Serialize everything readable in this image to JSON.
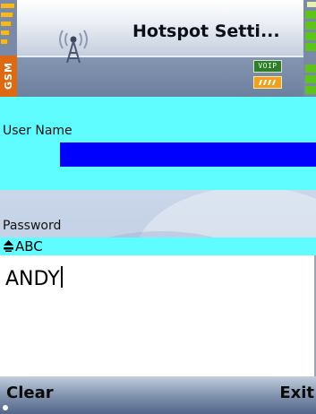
{
  "status_bar": {
    "title": "Hotspot Setti...",
    "network_label": "GSM",
    "voip_badge": "VOIP",
    "icons": {
      "signal": "signal-strength-icon",
      "battery": "battery-level-icon",
      "app": "wifi-tower-icon",
      "wifi": "wifi-badge-icon",
      "voip": "voip-badge-icon"
    }
  },
  "form": {
    "username_label": "User Name",
    "username_value": "",
    "password_label": "Password",
    "input_mode": "ABC",
    "password_value": "ANDY"
  },
  "softkeys": {
    "left": "Clear",
    "right": "Exit"
  },
  "colors": {
    "highlight": "#5ffdff",
    "selection": "#0000ff",
    "accent_orange": "#dd6a12",
    "signal_yellow": "#f6b81a",
    "battery_green": "#5fc41a"
  }
}
